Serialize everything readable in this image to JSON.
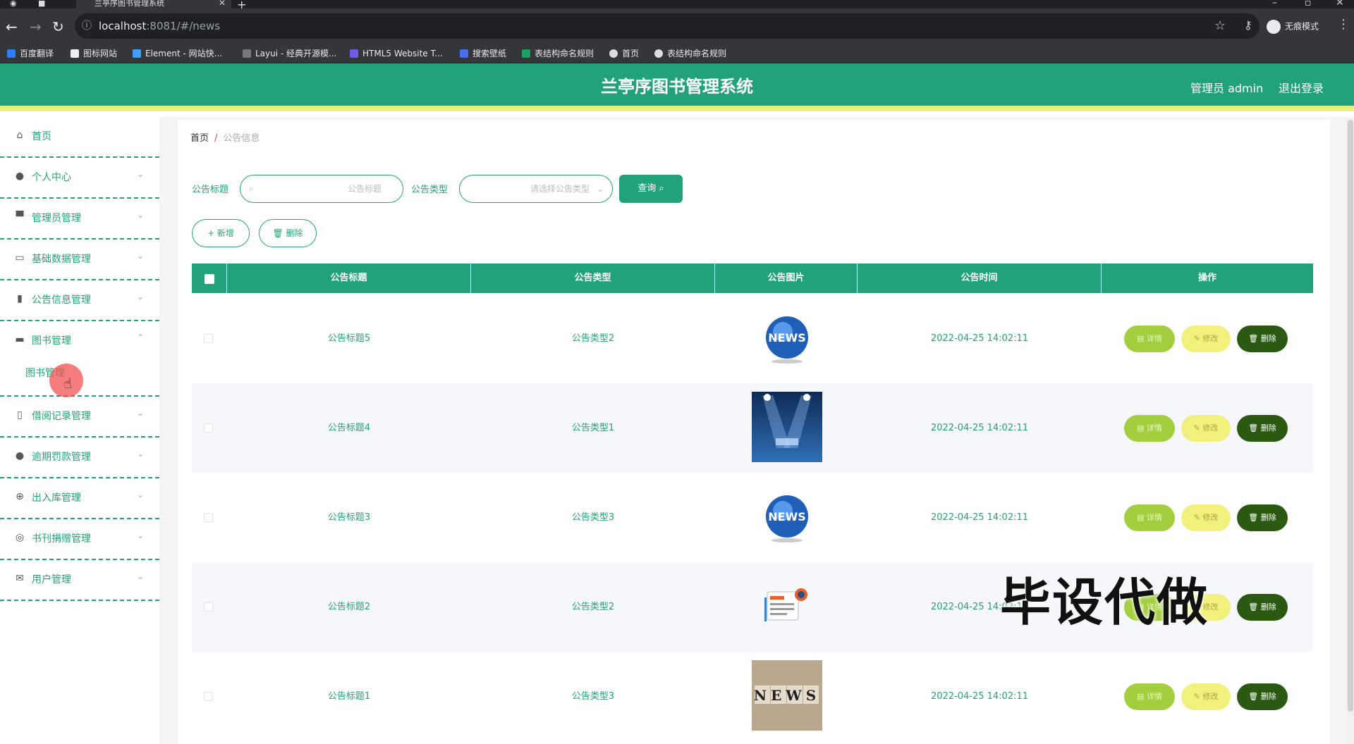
{
  "browser": {
    "tab_title": "兰亭序图书管理系统",
    "url_host": "localhost",
    "url_path": ":8081/#/news",
    "profile_label": "无痕模式",
    "bookmarks": [
      "百度翻译",
      "图标网站",
      "Element - 网站快...",
      "Layui - 经典开源模...",
      "HTML5 Website T...",
      "搜索壁纸",
      "表结构命名规则",
      "首页",
      "表结构命名规则"
    ]
  },
  "header": {
    "title": "兰亭序图书管理系统",
    "admin": "管理员 admin",
    "logout": "退出登录"
  },
  "sidebar": {
    "items": [
      {
        "label": "首页",
        "icon": "home-icon"
      },
      {
        "label": "个人中心",
        "icon": "user-icon"
      },
      {
        "label": "管理员管理",
        "icon": "monitor-icon"
      },
      {
        "label": "基础数据管理",
        "icon": "chat-icon"
      },
      {
        "label": "公告信息管理",
        "icon": "clipboard-icon"
      },
      {
        "label": "图书管理",
        "icon": "message-icon"
      },
      {
        "label": "借阅记录管理",
        "icon": "phone-icon"
      },
      {
        "label": "逾期罚款管理",
        "icon": "balloon-icon"
      },
      {
        "label": "出入库管理",
        "icon": "compass-icon"
      },
      {
        "label": "书刊捐赠管理",
        "icon": "gauge-icon"
      },
      {
        "label": "用户管理",
        "icon": "mail-icon"
      }
    ],
    "sub_item": "图书管理"
  },
  "breadcrumb": {
    "home": "首页",
    "current": "公告信息"
  },
  "search": {
    "title_label": "公告标题",
    "title_placeholder": "公告标题",
    "type_label": "公告类型",
    "type_placeholder": "请选择公告类型",
    "query_button": "查询 ⌕"
  },
  "toolbar": {
    "add": "+ 新增",
    "delete": "🗑 删除"
  },
  "table": {
    "headers": [
      "公告标题",
      "公告类型",
      "公告图片",
      "公告时间",
      "操作"
    ],
    "rows": [
      {
        "title": "公告标题5",
        "type": "公告类型2",
        "image": "globe-news",
        "time": "2022-04-25 14:02:11"
      },
      {
        "title": "公告标题4",
        "type": "公告类型1",
        "image": "spotlight-stage",
        "time": "2022-04-25 14:02:11"
      },
      {
        "title": "公告标题3",
        "type": "公告类型3",
        "image": "globe-news",
        "time": "2022-04-25 14:02:11"
      },
      {
        "title": "公告标题2",
        "type": "公告类型2",
        "image": "newspaper-icon",
        "time": "2022-04-25 14:02:11"
      },
      {
        "title": "公告标题1",
        "type": "公告类型3",
        "image": "news-blocks",
        "time": "2022-04-25 14:02:11"
      }
    ],
    "actions": {
      "detail": "▤ 详情",
      "edit": "✎ 修改",
      "delete": "🗑 删除"
    }
  },
  "overlay_text": "毕设代做",
  "colors": {
    "primary": "#22a27a",
    "accent_bar": "#e9f27a",
    "detail": "#a3cf3f",
    "edit": "#f0f07a",
    "delete": "#2a5a12"
  }
}
